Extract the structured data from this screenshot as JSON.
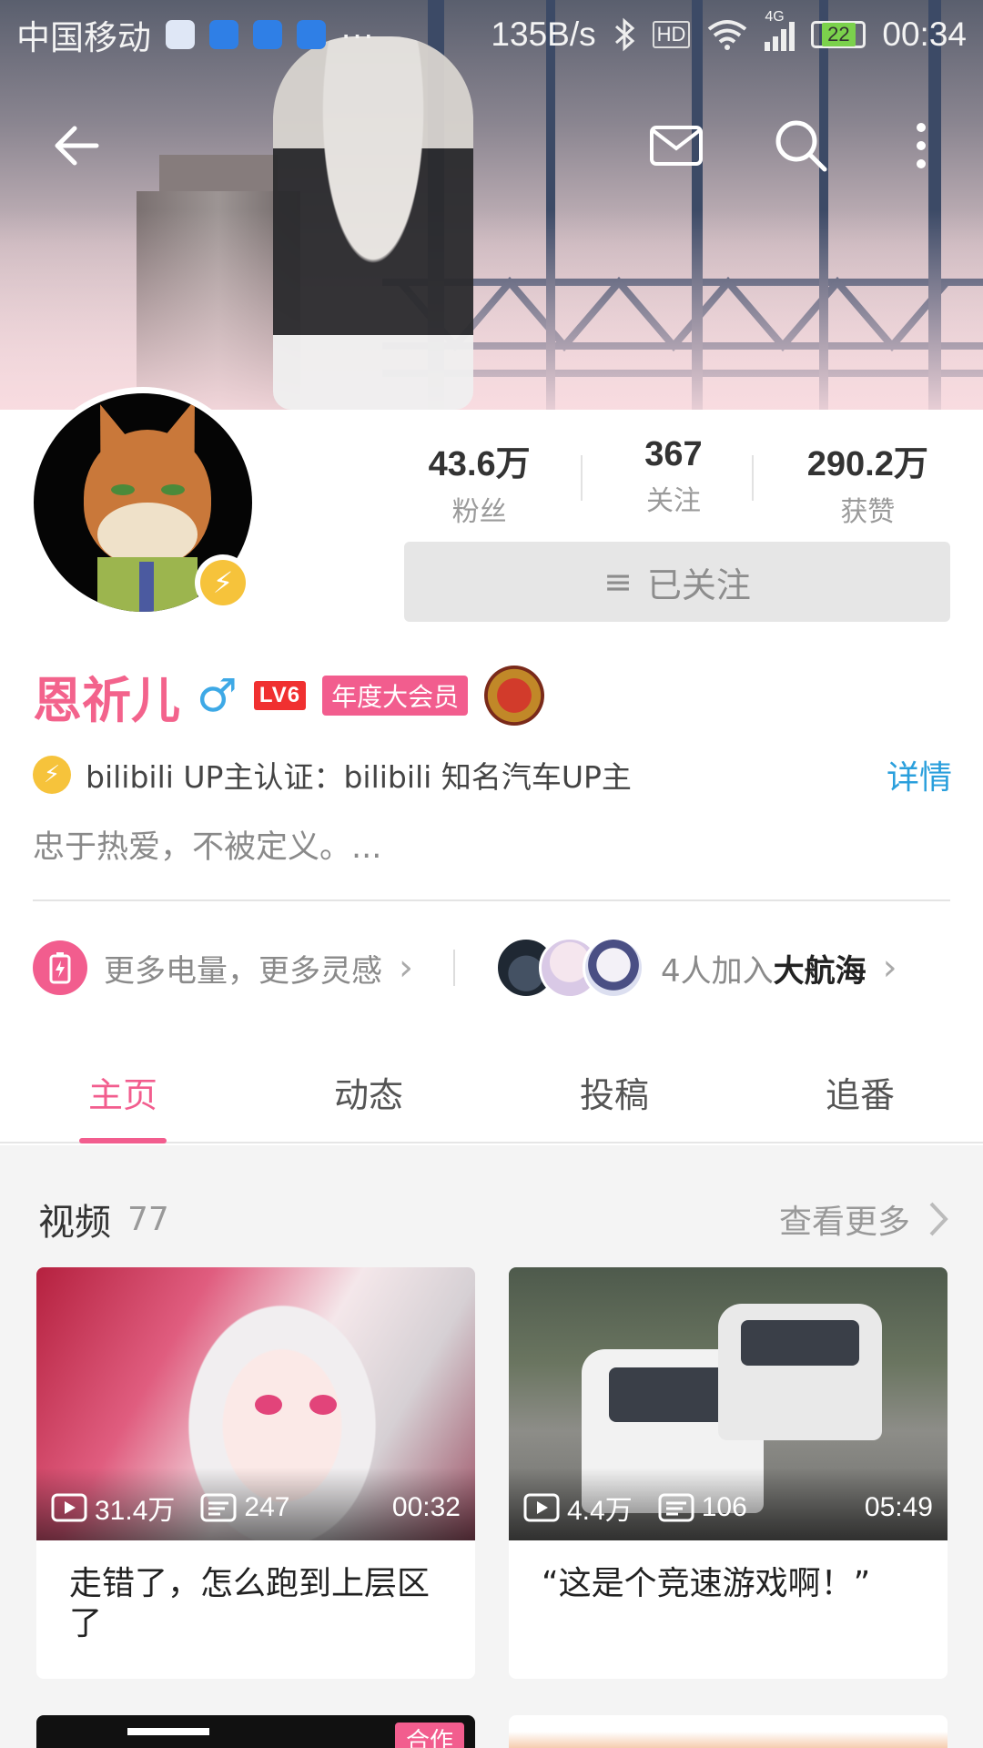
{
  "status_bar": {
    "carrier": "中国移动",
    "more_dots": "···",
    "net_speed": "135B/s",
    "hd_label": "HD",
    "network_type": "4G",
    "battery_level": "22",
    "time": "00:34"
  },
  "nav": {
    "back_icon": "arrow-left-icon",
    "mail_icon": "mail-icon",
    "search_icon": "search-icon",
    "more_icon": "more-vertical-icon"
  },
  "stats": [
    {
      "value": "43.6万",
      "label": "粉丝"
    },
    {
      "value": "367",
      "label": "关注"
    },
    {
      "value": "290.2万",
      "label": "获赞"
    }
  ],
  "follow_button": {
    "icon": "≡",
    "label": "已关注"
  },
  "profile": {
    "name": "恩祈儿",
    "gender_symbol": "♂",
    "level": "LV6",
    "vip_badge": "年度大会员",
    "cert_text": "bilibili UP主认证：bilibili 知名汽车UP主",
    "cert_detail": "详情",
    "bio": "忠于热爱，不被定义。..."
  },
  "extras": {
    "charge_text": "更多电量，更多灵感",
    "guard_prefix": "4人加入",
    "guard_bold": "大航海",
    "chevron": "›"
  },
  "tabs": [
    {
      "label": "主页",
      "active": true
    },
    {
      "label": "动态",
      "active": false
    },
    {
      "label": "投稿",
      "active": false
    },
    {
      "label": "追番",
      "active": false
    }
  ],
  "videos_section": {
    "title": "视频",
    "count": "77",
    "more": "查看更多",
    "items": [
      {
        "views": "31.4万",
        "danmaku": "247",
        "duration": "00:32",
        "title": "走错了，怎么跑到上层区了"
      },
      {
        "views": "4.4万",
        "danmaku": "106",
        "duration": "05:49",
        "title": "“这是个竞速游戏啊！”"
      }
    ],
    "next_row_badge": "合作"
  },
  "colors": {
    "brand_pink": "#f25d8e",
    "link_blue": "#2a9fdc",
    "gender_blue": "#3ea9e6",
    "level_red": "#f03030",
    "cert_yellow": "#f6c33b"
  }
}
